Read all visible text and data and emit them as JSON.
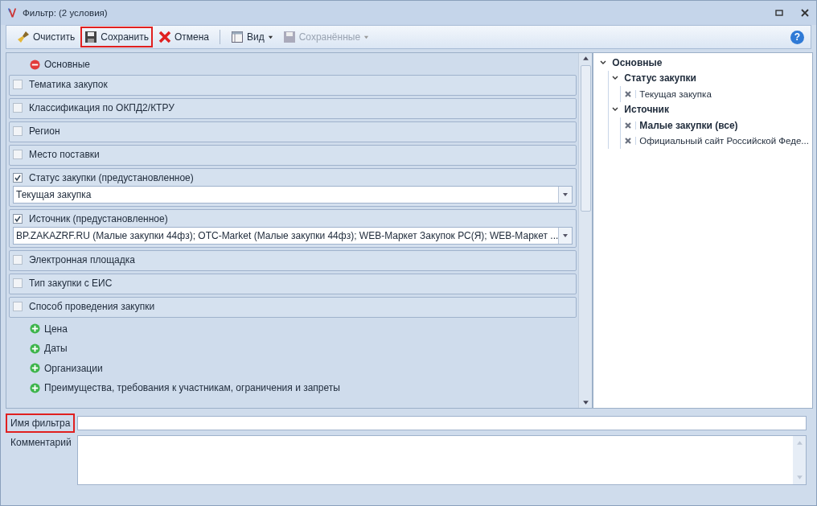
{
  "window": {
    "title": "Фильтр: (2 условия)"
  },
  "toolbar": [
    {
      "label": "Очистить",
      "disabled": false,
      "highlighted": false,
      "has_menu": false
    },
    {
      "label": "Сохранить",
      "disabled": false,
      "highlighted": true,
      "has_menu": false
    },
    {
      "label": "Отмена",
      "disabled": false,
      "highlighted": false,
      "has_menu": false
    },
    {
      "label": "Вид",
      "disabled": false,
      "highlighted": false,
      "has_menu": true
    },
    {
      "label": "Сохранённые",
      "disabled": true,
      "highlighted": false,
      "has_menu": true
    }
  ],
  "help": {
    "label": "?"
  },
  "main_section": {
    "label": "Основные",
    "expanded": true
  },
  "conditions": [
    {
      "label": "Тематика закупок",
      "checked": false
    },
    {
      "label": "Классификация по ОКПД2/КТРУ",
      "checked": false
    },
    {
      "label": "Регион",
      "checked": false
    },
    {
      "label": "Место поставки",
      "checked": false
    },
    {
      "label": "Статус закупки (предустановленное)",
      "checked": true,
      "value": "Текущая закупка"
    },
    {
      "label": "Источник (предустановленное)",
      "checked": true,
      "value": "BP.ZAKAZRF.RU (Малые закупки 44фз); OTC-Market (Малые закупки 44фз); WEB-Маркет Закупок РС(Я); WEB-Маркет ..."
    },
    {
      "label": "Электронная площадка",
      "checked": false
    },
    {
      "label": "Тип закупки с ЕИС",
      "checked": false
    },
    {
      "label": "Способ проведения закупки",
      "checked": false
    }
  ],
  "sections": [
    {
      "label": "Цена",
      "expanded": false
    },
    {
      "label": "Даты",
      "expanded": false
    },
    {
      "label": "Организации",
      "expanded": false
    },
    {
      "label": "Преимущества, требования к участникам, ограничения и запреты",
      "expanded": false
    }
  ],
  "tree": [
    {
      "label": "Основные",
      "expanded": true,
      "children": [
        {
          "label": "Статус закупки",
          "expanded": true,
          "children": [
            {
              "label": "Текущая закупка",
              "bold": false
            }
          ]
        },
        {
          "label": "Источник",
          "expanded": true,
          "children": [
            {
              "label": "Малые закупки (все)",
              "bold": true
            },
            {
              "label": "Официальный сайт Российской Феде...",
              "bold": false
            }
          ]
        }
      ]
    }
  ],
  "filter_name": {
    "label": "Имя фильтра",
    "highlighted": true
  },
  "comment": {
    "label": "Комментарий"
  }
}
